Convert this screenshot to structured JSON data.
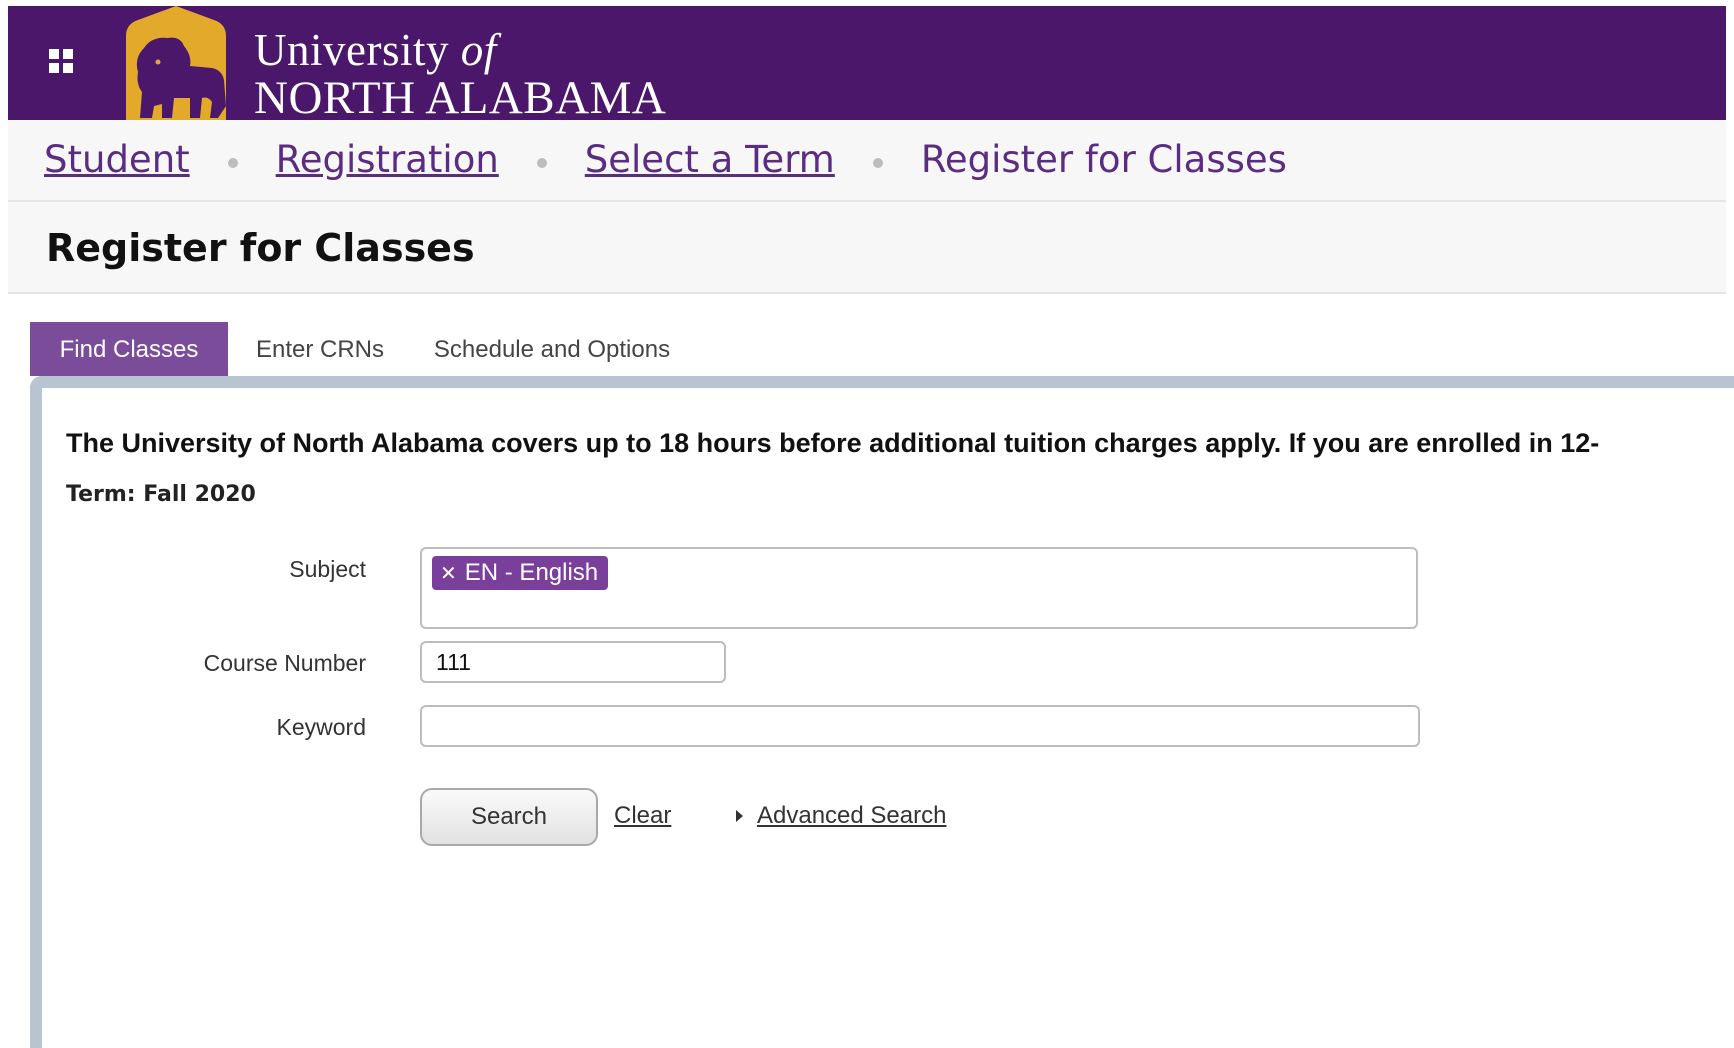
{
  "brand": {
    "line1_main": "University",
    "line1_of": "of",
    "line2": "NORTH ALABAMA",
    "purple": "#4a176b",
    "gold": "#e3a92a"
  },
  "breadcrumb": {
    "items": [
      "Student",
      "Registration",
      "Select a Term"
    ],
    "current": "Register for Classes"
  },
  "page": {
    "title": "Register for Classes"
  },
  "tabs": [
    {
      "label": "Find Classes",
      "active": true
    },
    {
      "label": "Enter CRNs",
      "active": false
    },
    {
      "label": "Schedule and Options",
      "active": false
    }
  ],
  "content": {
    "notice": "The University of North Alabama covers up to 18 hours before additional tuition charges apply. If you are enrolled in 12-",
    "term_label": "Term:",
    "term_value": "Fall 2020"
  },
  "form": {
    "subject_label": "Subject",
    "subject_chip": "EN - English",
    "course_label": "Course Number",
    "course_value": "111",
    "keyword_label": "Keyword",
    "keyword_value": "",
    "search_label": "Search",
    "clear_label": "Clear",
    "advanced_label": "Advanced Search"
  }
}
